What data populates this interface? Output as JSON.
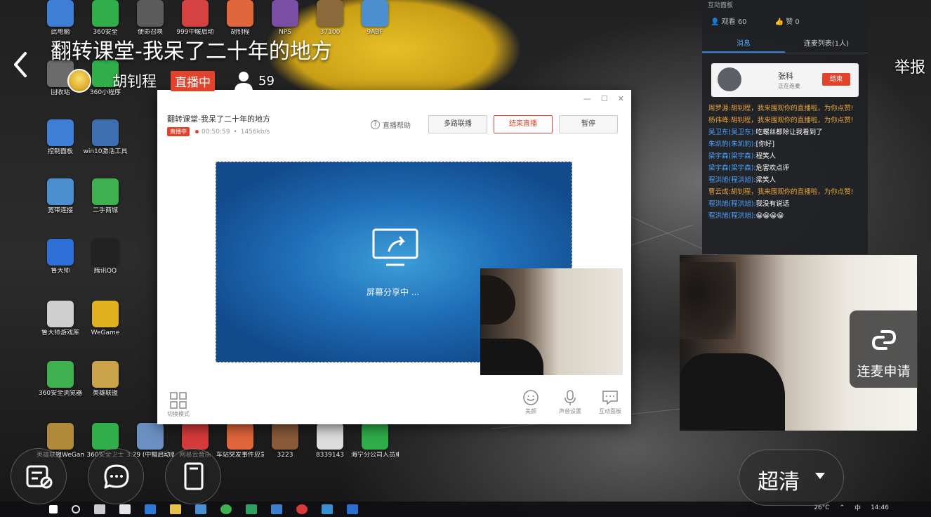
{
  "stream": {
    "title": "翻转课堂-我呆了二十年的地方",
    "host_name": "胡钊程",
    "live_badge": "直播中",
    "viewer_count": "59",
    "report_label": "举报"
  },
  "panel": {
    "header": "互动面板",
    "views": "观看 60",
    "likes": "赞 0",
    "tabs": [
      {
        "label": "消息"
      },
      {
        "label": "连麦列表(1人)"
      }
    ],
    "mic_user": {
      "name": "张科",
      "status": "正在连麦",
      "end_label": "结束"
    },
    "messages": [
      {
        "user": "周罗源:",
        "text": "胡钊程，我来围观你的直播啦，为你点赞!",
        "sys": true
      },
      {
        "user": "杨伟峰:",
        "text": "胡钊程，我来围观你的直播啦，为你点赞!",
        "sys": true
      },
      {
        "user": "吴卫东(吴卫东):",
        "text": "吃螺丝都除让我看到了",
        "sys": false
      },
      {
        "user": "朱凯豹(朱凯豹):",
        "text": "[你好]",
        "sys": false
      },
      {
        "user": "梁宇森(梁宇森):",
        "text": "程笑人",
        "sys": false
      },
      {
        "user": "梁宇森(梁宇森):",
        "text": "危害欢点评",
        "sys": false
      },
      {
        "user": "程洪旭(程洪旭):",
        "text": "梁笑人",
        "sys": false
      },
      {
        "user": "曹云成:",
        "text": "胡钊程，我来围观你的直播啦，为你点赞!",
        "sys": true
      },
      {
        "user": "程洪旭(程洪旭):",
        "text": "我没有说话",
        "sys": false
      },
      {
        "user": "程洪旭(程洪旭):",
        "text": "😀😀😀😀",
        "sys": false
      }
    ]
  },
  "client": {
    "title": "翻转课堂-我呆了二十年的地方",
    "badge": "直播中",
    "elapsed": "00:50:59",
    "bitrate": "1456kb/s",
    "help_label": "直播帮助",
    "multi_mic_label": "多路联播",
    "end_live_label": "结束直播",
    "pause_label": "暂停",
    "share_text": "屏幕分享中 ...",
    "layout_label": "切换模式",
    "bottom_buttons": [
      {
        "label": "美颜"
      },
      {
        "label": "声音设置"
      },
      {
        "label": "互动面板"
      }
    ]
  },
  "desktop_icons": [
    {
      "label": "此电脑",
      "color": "#3d7fd6"
    },
    {
      "label": "360安全",
      "color": "#2fae4a"
    },
    {
      "label": "使命召唤",
      "color": "#5b5b5b"
    },
    {
      "label": "999中暖启动",
      "color": "#d64242"
    },
    {
      "label": "胡钊程",
      "color": "#e0663c"
    },
    {
      "label": "NPS",
      "color": "#7a4ea3"
    },
    {
      "label": "37100",
      "color": "#8a6a3a"
    },
    {
      "label": "9ABF",
      "color": "#4b8fd0"
    },
    {
      "label": "回收站",
      "color": "#6b6b6b"
    },
    {
      "label": "360小程序",
      "color": "#2fae4a"
    },
    {
      "label": "控制面板",
      "color": "#3d7fd6"
    },
    {
      "label": "win10激活工具",
      "color": "#3d6fb0"
    },
    {
      "label": "宽带连接",
      "color": "#4b8fd0"
    },
    {
      "label": "二手商城",
      "color": "#3fb050"
    },
    {
      "label": "鲁大师",
      "color": "#2d6fd6"
    },
    {
      "label": "腾讯QQ",
      "color": "#222222"
    },
    {
      "label": "鲁大师游戏库",
      "color": "#cfcfcf"
    },
    {
      "label": "WeGame",
      "color": "#e0b020"
    },
    {
      "label": "360安全浏览器",
      "color": "#3fb050"
    },
    {
      "label": "英雄联盟",
      "color": "#c9a24a"
    },
    {
      "label": "英雄联盟WeGame版",
      "color": "#b08a3a"
    },
    {
      "label": "360安全卫士",
      "color": "#2fae4a"
    },
    {
      "label": "3.29 (中鳗启动版)",
      "color": "#6a8fc0"
    },
    {
      "label": "网易云音乐",
      "color": "#d63a3a"
    },
    {
      "label": "车站突发事件应急处置",
      "color": "#e0663c"
    },
    {
      "label": "3223",
      "color": "#8a5a3a"
    },
    {
      "label": "8339143",
      "color": "#dddddd"
    },
    {
      "label": "海宁分公司人员重点区...",
      "color": "#2fae4a"
    }
  ],
  "taskbar": {
    "weather": "26°C",
    "time": "14:46",
    "ime": "中"
  },
  "connect_label": "连麦申请",
  "quality_label": "超清"
}
